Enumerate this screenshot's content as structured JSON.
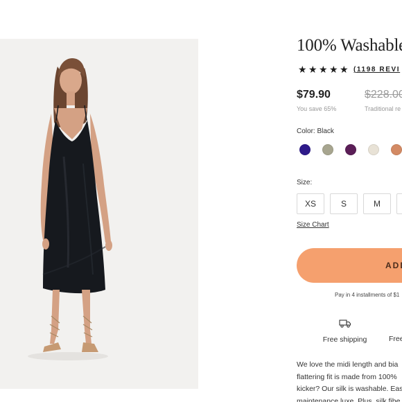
{
  "product": {
    "title": "100% Washable",
    "rating_stars": 5,
    "reviews_text": "(1198 REVI",
    "price": "$79.90",
    "compare_price": "$228.00",
    "savings": "You save 65%",
    "traditional_label": "Traditional re",
    "color_label": "Color: Black",
    "swatches": [
      {
        "name": "indigo",
        "color": "#2e1a8a"
      },
      {
        "name": "sage",
        "color": "#a7a58f"
      },
      {
        "name": "plum",
        "color": "#5b1e57"
      },
      {
        "name": "cream",
        "color": "#e8e2d6"
      },
      {
        "name": "terracotta",
        "color": "#d38a64"
      }
    ],
    "size_label": "Size:",
    "sizes": [
      "XS",
      "S",
      "M"
    ],
    "size_chart": "Size Chart",
    "add_button": "ADD",
    "installments": "Pay in 4 installments of $1",
    "shipping": "Free shipping",
    "returns": "Free",
    "description_lines": [
      "We love the midi length and bia",
      "flattering fit is made from 100%",
      "kicker? Our silk is washable. Eas",
      "maintenance luxe. Plus, silk fibe"
    ]
  },
  "colors": {
    "accent": "#f5a06e",
    "image_bg": "#f2f1ef",
    "dress": "#16191e"
  }
}
